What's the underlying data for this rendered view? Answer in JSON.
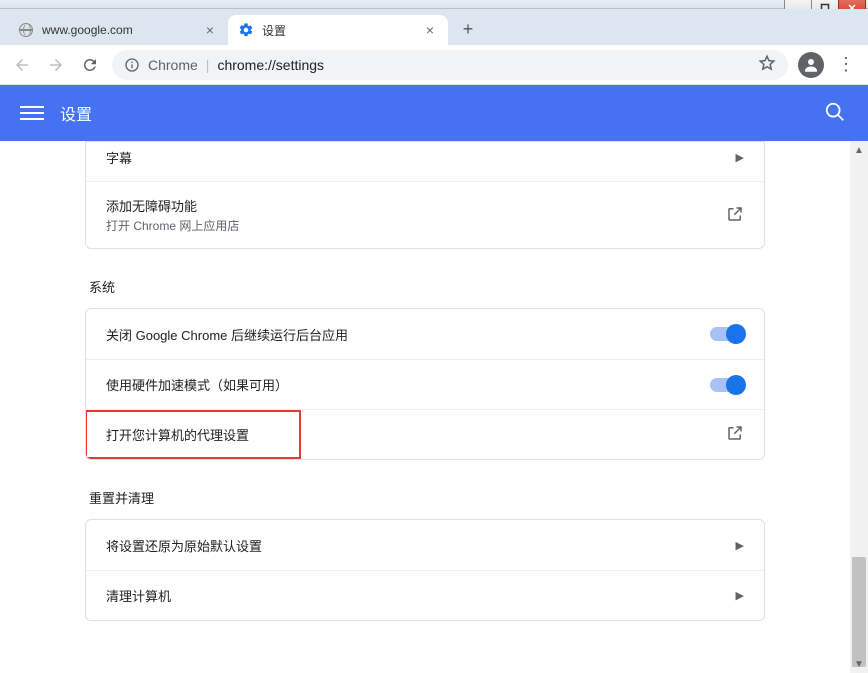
{
  "window": {
    "tabs": [
      {
        "title": "www.google.com",
        "active": false
      },
      {
        "title": "设置",
        "active": true
      }
    ]
  },
  "toolbar": {
    "chrome_label": "Chrome",
    "url": "chrome://settings"
  },
  "header": {
    "title": "设置"
  },
  "sections": {
    "accessibility": {
      "captions_label": "字幕",
      "add_label": "添加无障碍功能",
      "add_sub": "打开 Chrome 网上应用店"
    },
    "system": {
      "title": "系统",
      "bg_apps": "关闭 Google Chrome 后继续运行后台应用",
      "hw_accel": "使用硬件加速模式（如果可用）",
      "proxy": "打开您计算机的代理设置"
    },
    "reset": {
      "title": "重置并清理",
      "restore": "将设置还原为原始默认设置",
      "cleanup": "清理计算机"
    }
  }
}
